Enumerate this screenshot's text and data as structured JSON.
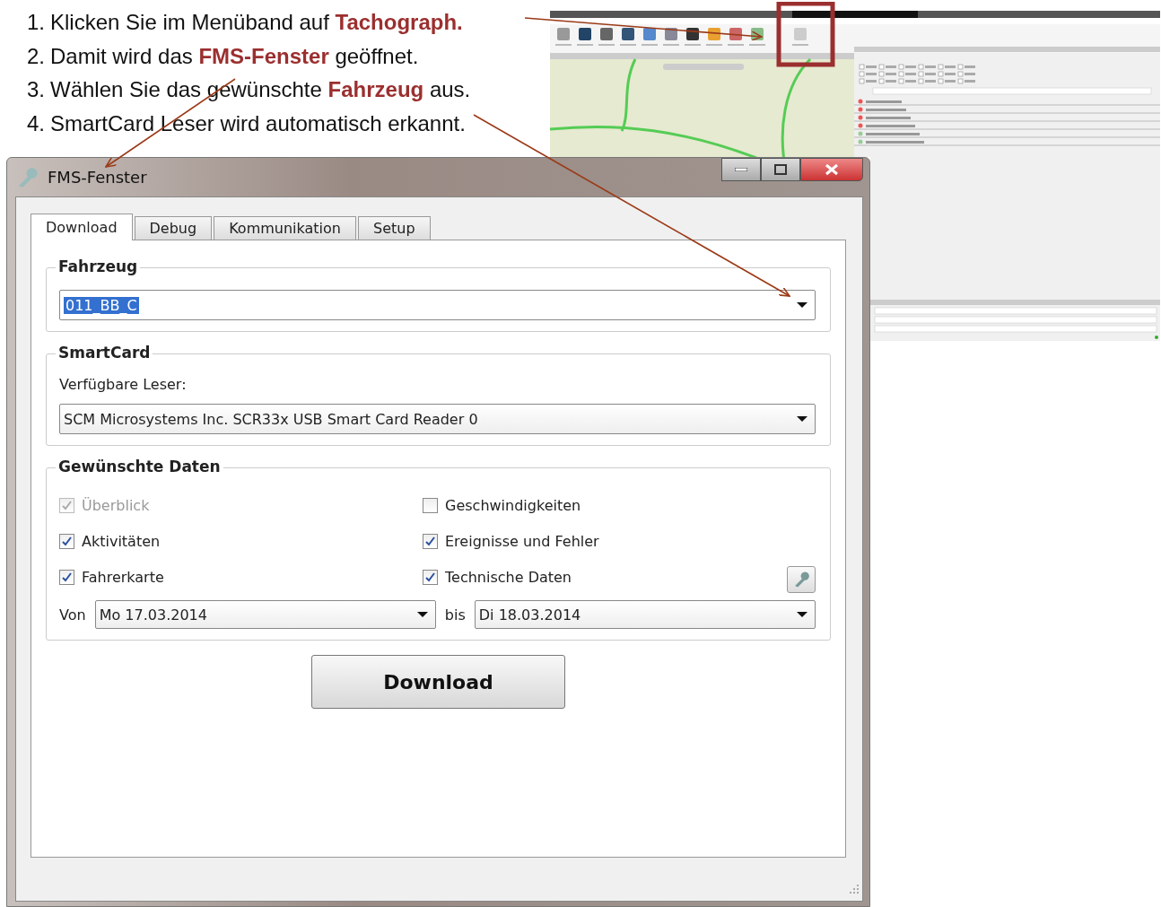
{
  "instructions": [
    {
      "number": "1.",
      "text": "Klicken Sie im Menüband auf **Tachograph.**"
    },
    {
      "number": "2.",
      "text": "Damit wird das **FMS-Fenster** geöffnet."
    },
    {
      "number": "3.",
      "text": "Wählen Sie das gewünschte **Fahrzeug** aus."
    },
    {
      "number": "4.",
      "text": "SmartCard Leser wird automatisch erkannt."
    }
  ],
  "window": {
    "title": "FMS-Fenster"
  },
  "tabs": [
    {
      "label": "Download",
      "selected": true
    },
    {
      "label": "Debug",
      "selected": false
    },
    {
      "label": "Kommunikation",
      "selected": false
    },
    {
      "label": "Setup",
      "selected": false
    }
  ],
  "vehicle_group": {
    "title": "Fahrzeug",
    "value": "011_BB_C",
    "highlighted": true
  },
  "smartcard_group": {
    "title": "SmartCard",
    "label": "Verfügbare Leser:",
    "value": "SCM Microsystems Inc. SCR33x USB Smart Card Reader 0"
  },
  "data_group": {
    "title": "Gewünschte Daten",
    "options": [
      {
        "label": "Überblick",
        "checked": true,
        "disabled": true
      },
      {
        "label": "Geschwindigkeiten",
        "checked": false,
        "disabled": false
      },
      {
        "label": "Aktivitäten",
        "checked": true,
        "disabled": false
      },
      {
        "label": "Ereignisse und Fehler",
        "checked": true,
        "disabled": false
      },
      {
        "label": "Fahrerkarte",
        "checked": true,
        "disabled": false
      },
      {
        "label": "Technische Daten",
        "checked": true,
        "disabled": false
      }
    ],
    "from_label": "Von",
    "from_value": "Mo 17.03.2014",
    "to_label": "bis",
    "to_value": "Di 18.03.2014"
  },
  "download_button": "Download"
}
